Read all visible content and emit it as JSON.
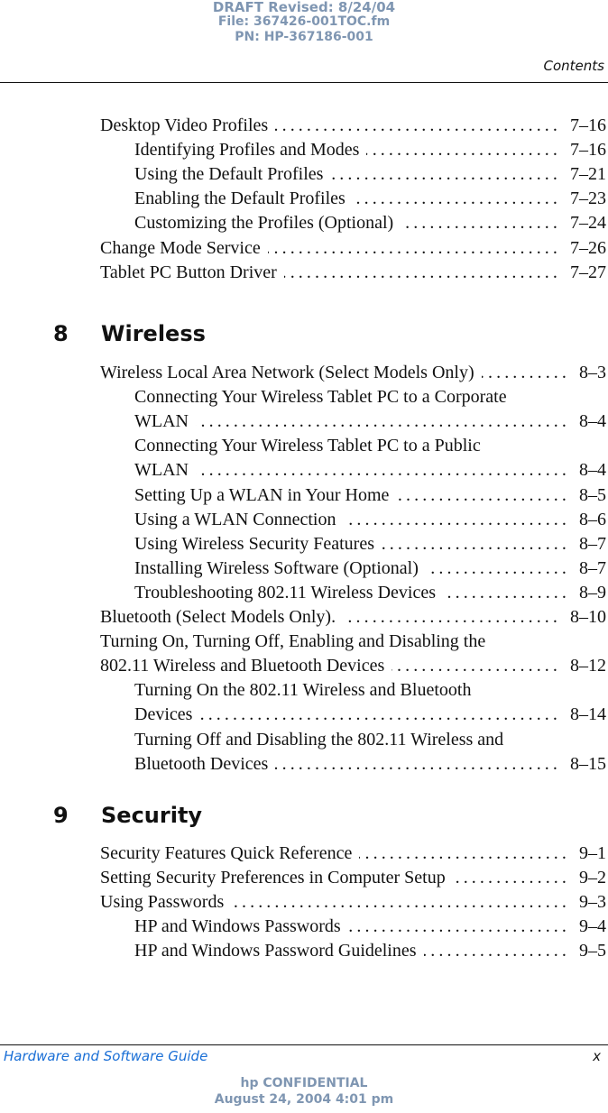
{
  "draft_stamp": {
    "line1": "DRAFT Revised: 8/24/04",
    "line2": "File: 367426-001TOC.fm",
    "line3": "PN: HP-367186-001"
  },
  "header": {
    "running_head": "Contents"
  },
  "toc": {
    "entries_before": [
      {
        "title": "Desktop Video Profiles",
        "page": "7–16",
        "level": 1
      },
      {
        "title": "Identifying Profiles and Modes",
        "page": "7–16",
        "level": 2
      },
      {
        "title": "Using the Default Profiles",
        "page": "7–21",
        "level": 2
      },
      {
        "title": "Enabling the Default Profiles",
        "page": "7–23",
        "level": 2
      },
      {
        "title": "Customizing the Profiles (Optional)",
        "page": "7–24",
        "level": 2
      },
      {
        "title": "Change Mode Service",
        "page": "7–26",
        "level": 1
      },
      {
        "title": "Tablet PC Button Driver",
        "page": "7–27",
        "level": 1
      }
    ],
    "chapters": [
      {
        "number": "8",
        "title": "Wireless",
        "entries": [
          {
            "title": "Wireless Local Area Network (Select Models Only)",
            "page": "8–3",
            "level": 1
          },
          {
            "title": "Connecting Your Wireless Tablet PC to a Corporate",
            "continuation": "WLAN",
            "page": "8–4",
            "level": 2
          },
          {
            "title": "Connecting Your Wireless Tablet PC to a Public",
            "continuation": "WLAN",
            "page": "8–4",
            "level": 2
          },
          {
            "title": "Setting Up a WLAN in Your Home",
            "page": "8–5",
            "level": 2
          },
          {
            "title": "Using a WLAN Connection",
            "page": "8–6",
            "level": 2
          },
          {
            "title": "Using Wireless Security Features",
            "page": "8–7",
            "level": 2
          },
          {
            "title": "Installing Wireless Software (Optional)",
            "page": "8–7",
            "level": 2
          },
          {
            "title": "Troubleshooting 802.11 Wireless Devices",
            "page": "8–9",
            "level": 2
          },
          {
            "title": "Bluetooth (Select Models Only).",
            "page": "8–10",
            "level": 1
          },
          {
            "title": "Turning On, Turning Off, Enabling and Disabling the",
            "continuation": "802.11 Wireless and Bluetooth Devices",
            "page": "8–12",
            "level": 1
          },
          {
            "title": "Turning On the 802.11 Wireless and Bluetooth",
            "continuation": "Devices",
            "page": "8–14",
            "level": 2
          },
          {
            "title": "Turning Off and Disabling the 802.11 Wireless and",
            "continuation": "Bluetooth Devices",
            "page": "8–15",
            "level": 2
          }
        ]
      },
      {
        "number": "9",
        "title": "Security",
        "entries": [
          {
            "title": "Security Features Quick Reference",
            "page": "9–1",
            "level": 1
          },
          {
            "title": "Setting Security Preferences in Computer Setup",
            "page": "9–2",
            "level": 1
          },
          {
            "title": "Using Passwords",
            "page": "9–3",
            "level": 1
          },
          {
            "title": "HP and Windows Passwords",
            "page": "9–4",
            "level": 2
          },
          {
            "title": "HP and Windows Password Guidelines",
            "page": "9–5",
            "level": 2
          }
        ]
      }
    ]
  },
  "footer": {
    "guide_title": "Hardware and Software Guide",
    "page_number": "x",
    "confidential_line1": "hp CONFIDENTIAL",
    "confidential_line2": "August 24, 2004 4:01 pm"
  },
  "colors": {
    "draft_stamp": "#7f96b2",
    "footer_title": "#1a6fd6",
    "text": "#111111"
  }
}
